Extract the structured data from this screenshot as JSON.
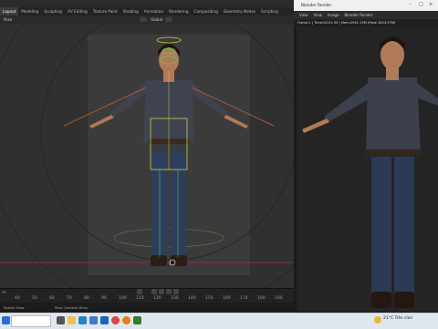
{
  "blender": {
    "workspace_tabs": [
      "Layout",
      "Modeling",
      "Sculpting",
      "UV Editing",
      "Texture Paint",
      "Shading",
      "Animation",
      "Rendering",
      "Compositing",
      "Geometry Nodes",
      "Scripting"
    ],
    "active_tab_index": 0,
    "viewport_header": {
      "mode_label": "Pose",
      "orientation": "Global"
    },
    "timeline": {
      "start_label": "er",
      "ticks": [
        "40",
        "50",
        "60",
        "70",
        "80",
        "90",
        "100",
        "110",
        "120",
        "130",
        "140",
        "150",
        "160",
        "170",
        "180",
        "190"
      ]
    },
    "status_bar": {
      "left": "Rotate View",
      "center": "Pose Context Menu"
    }
  },
  "render_window": {
    "title": "Blender Render",
    "menu": [
      "View",
      "View",
      "Image",
      "Blender Render"
    ],
    "info_text": "Frame:1 | Time:00:01.00 | Mem:2941.19M (Peak 3453.57M)"
  },
  "taskbar": {
    "weather": "21°C  Très clair",
    "icons": [
      "windows-icon",
      "task-view-icon",
      "explorer-icon",
      "edge-icon",
      "chrome-icon",
      "blender-icon",
      "mail-icon",
      "store-icon"
    ]
  },
  "colors": {
    "bone_highlight": "#c8d43a",
    "ground_line": "#b02a2a",
    "accent": "#4772b3"
  }
}
